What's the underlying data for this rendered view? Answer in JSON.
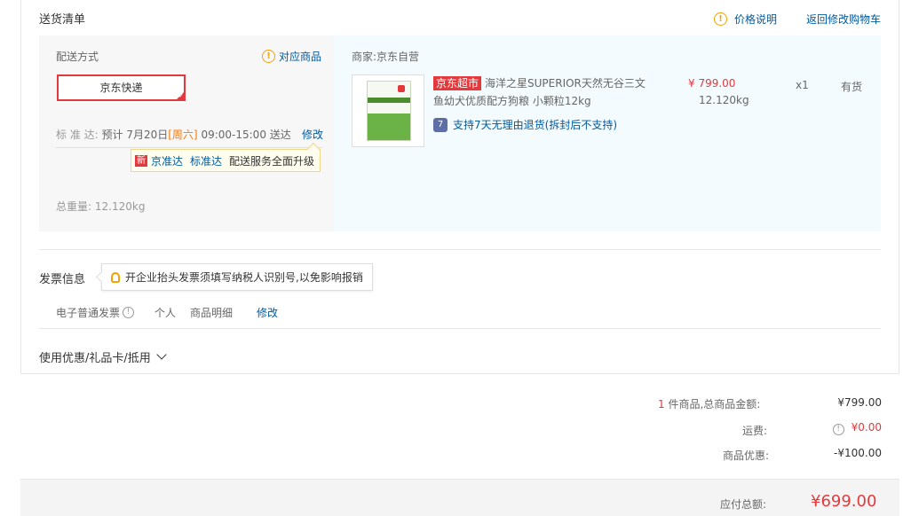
{
  "header": {
    "title": "送货清单",
    "price_note": "价格说明",
    "back_to_cart": "返回修改购物车"
  },
  "shipping": {
    "label": "配送方式",
    "match_goods": "对应商品",
    "selected_option": "京东快递",
    "standard_label": "标 准 达:",
    "standard_prefix": "预计 7月20日",
    "standard_day": "[周六]",
    "standard_time": "09:00-15:00 送达",
    "modify": "修改",
    "upgrade_tip": {
      "new_tag": "新",
      "link1": "京准达",
      "link2": "标准达",
      "text": "配送服务全面升级"
    },
    "weight_label": "总重量:",
    "weight_value": "12.120kg"
  },
  "goods": {
    "seller": "商家:京东自营",
    "tag": "京东超市",
    "name": "海洋之星SUPERIOR天然无谷三文鱼幼犬优质配方狗粮 小颗粒12kg",
    "return_icon": "7",
    "return_policy": "支持7天无理由退货(拆封后不支持)",
    "price": "¥ 799.00",
    "weight": "12.120kg",
    "quantity": "x1",
    "stock": "有货"
  },
  "invoice": {
    "title": "发票信息",
    "tip": "开企业抬头发票须填写纳税人识别号,以免影响报销",
    "type": "电子普通发票",
    "personal": "个人",
    "detail": "商品明细",
    "modify": "修改"
  },
  "coupon": {
    "label": "使用优惠/礼品卡/抵用"
  },
  "summary": {
    "count": "1",
    "count_suffix": "件商品,总商品金额:",
    "goods_amount": "¥799.00",
    "freight_label": "运费:",
    "freight_value": "¥0.00",
    "discount_label": "商品优惠:",
    "discount_value": "-¥100.00",
    "payable_label": "应付总额:",
    "payable_value": "¥699.00"
  },
  "colors": {
    "accent_red": "#e4393c",
    "link_blue": "#005aa0",
    "warn_orange": "#f7a100"
  },
  "icons": {
    "price_note": "warning-circle-icon",
    "match_goods": "warning-circle-icon",
    "selected": "checkmark-corner-icon",
    "return": "seven-days-return-icon",
    "invoice_tip": "lightbulb-icon",
    "invoice_info": "info-circle-icon",
    "coupon_toggle": "chevron-down-icon",
    "freight_info": "info-circle-icon"
  }
}
